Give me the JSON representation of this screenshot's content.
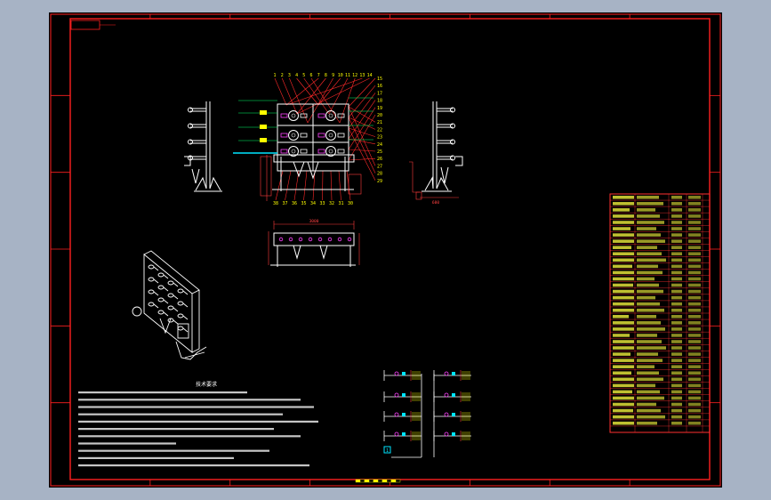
{
  "colors": {
    "viewport_bg": "#a7b3c5",
    "sheet_bg": "#000000",
    "frame": "#ff2020",
    "geometry": "#ffffff",
    "dimension": "#ff3b3b",
    "leader": "#ff2a2a",
    "callout": "#ffff00",
    "annotation": "#00ff66",
    "table_text": "#ffff40",
    "table_line": "#ff3030",
    "accent_cyan": "#00e5ff",
    "accent_magenta": "#ff40ff"
  },
  "drawing": {
    "title_stamp": "",
    "callouts_top": [
      "1",
      "2",
      "3",
      "4",
      "5",
      "6",
      "7",
      "8",
      "9",
      "10",
      "11",
      "12",
      "13",
      "14"
    ],
    "callouts_right": [
      "15",
      "16",
      "17",
      "18",
      "19",
      "20",
      "21",
      "22",
      "23",
      "24",
      "25",
      "26",
      "27",
      "28",
      "29"
    ],
    "callouts_bottom": [
      "30",
      "31",
      "32",
      "33",
      "34",
      "35",
      "36",
      "37",
      "38"
    ],
    "dimension_top": "3000",
    "dimension_side": "600",
    "notes_heading": "技术要求",
    "detail_marker": "1"
  }
}
